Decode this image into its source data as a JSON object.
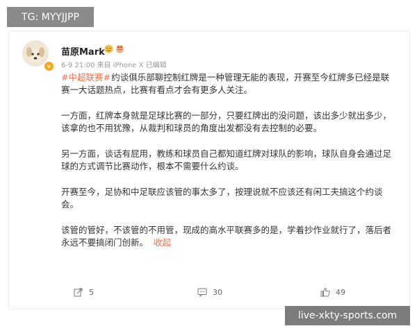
{
  "overlay": {
    "tag": "TG: MYYJJPP",
    "watermark": "live-xkty-sports.com"
  },
  "post": {
    "author": "苗原Mark",
    "meta": "6-9 21:00 来自 iPhone X 已编辑",
    "topic": "#中超联赛#",
    "paragraphs": [
      "约谈俱乐部聊控制红牌是一种管理无能的表现，开赛至今红牌多已经是联赛一大话题热点，比赛有看点才会有更多人关注。",
      "一方面，红牌本身就是足球比赛的一部分，只要红牌出的没问题，该出多少就出多少，该拿的也不用犹豫，从裁判和球员的角度出发都没有去控制的必要。",
      "另一方面，谈话有屁用，教练和球员自己都知道红牌对球队的影响，球队自身会通过足球的方式调节比赛动作，根本不需要什么约谈。",
      "开赛至今，足协和中足联应该管的事太多了，按理说就不应该还有闲工夫搞这个约谈会。",
      "该管的管好，不该管的不用管，现成的高水平联赛多的是，学着抄作业就行了，落后者永远不要搞闭门创新。"
    ],
    "collapse": "收起"
  },
  "actions": {
    "repost": "5",
    "comment": "30",
    "like": "49"
  },
  "icons": [
    "verified-badge-icon",
    "emoji-icon",
    "repost-icon",
    "comment-icon",
    "like-icon"
  ],
  "colors": {
    "topic": "#eb7350",
    "verified": "#f5a623"
  }
}
